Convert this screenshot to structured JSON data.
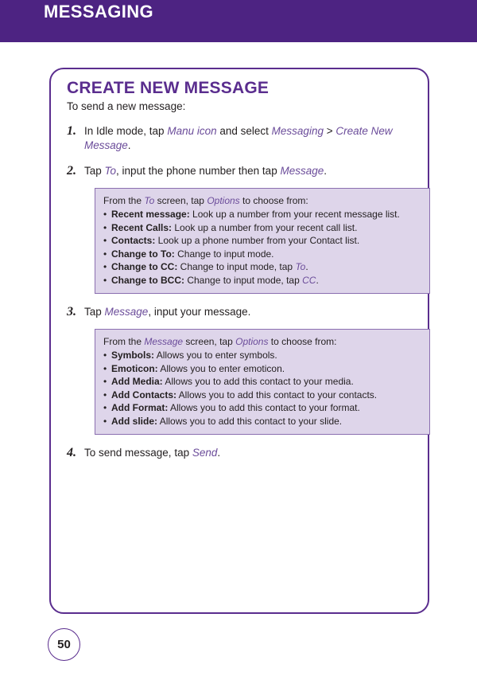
{
  "header": {
    "title": "MESSAGING",
    "bar_color": "#4d2382"
  },
  "card": {
    "section_title": "CREATE NEW MESSAGE",
    "intro": "To send a new message:",
    "border_color": "#5a2d8e",
    "accent_color": "#6b4c9a"
  },
  "steps": [
    {
      "number": "1.",
      "parts": [
        {
          "text": "In Idle mode, tap ",
          "style": "normal"
        },
        {
          "text": "Manu icon",
          "style": "em"
        },
        {
          "text": " and select ",
          "style": "normal"
        },
        {
          "text": "Messaging",
          "style": "em"
        },
        {
          "text": " > ",
          "style": "normal"
        },
        {
          "text": "Create New Message",
          "style": "em"
        },
        {
          "text": ".",
          "style": "normal"
        }
      ]
    },
    {
      "number": "2.",
      "parts": [
        {
          "text": "Tap ",
          "style": "normal"
        },
        {
          "text": "To",
          "style": "em"
        },
        {
          "text": ", input the phone number then tap ",
          "style": "normal"
        },
        {
          "text": "Message",
          "style": "em"
        },
        {
          "text": ".",
          "style": "normal"
        }
      ]
    },
    {
      "number": "3.",
      "parts": [
        {
          "text": "Tap ",
          "style": "normal"
        },
        {
          "text": "Message",
          "style": "em"
        },
        {
          "text": ", input your message.",
          "style": "normal"
        }
      ]
    },
    {
      "number": "4.",
      "parts": [
        {
          "text": "To send message, tap ",
          "style": "normal"
        },
        {
          "text": "Send",
          "style": "em"
        },
        {
          "text": ".",
          "style": "normal"
        }
      ]
    }
  ],
  "infobox_to": {
    "lead_parts": [
      {
        "text": "From the ",
        "style": "normal"
      },
      {
        "text": "To",
        "style": "em"
      },
      {
        "text": " screen, tap ",
        "style": "normal"
      },
      {
        "text": "Options",
        "style": "em"
      },
      {
        "text": " to choose from:",
        "style": "normal"
      }
    ],
    "items": [
      {
        "parts": [
          {
            "text": "Recent message:",
            "style": "bold"
          },
          {
            "text": " Look up a number from your recent message list.",
            "style": "normal"
          }
        ]
      },
      {
        "parts": [
          {
            "text": "Recent Calls:",
            "style": "bold"
          },
          {
            "text": " Look up a number from your recent call list.",
            "style": "normal"
          }
        ]
      },
      {
        "parts": [
          {
            "text": "Contacts:",
            "style": "bold"
          },
          {
            "text": " Look up a phone number from your Contact list.",
            "style": "normal"
          }
        ]
      },
      {
        "parts": [
          {
            "text": "Change to To:",
            "style": "bold"
          },
          {
            "text": " Change to input mode.",
            "style": "normal"
          }
        ]
      },
      {
        "parts": [
          {
            "text": "Change to CC:",
            "style": "bold"
          },
          {
            "text": " Change to input mode, tap ",
            "style": "normal"
          },
          {
            "text": "To",
            "style": "em"
          },
          {
            "text": ".",
            "style": "normal"
          }
        ]
      },
      {
        "parts": [
          {
            "text": "Change to BCC:",
            "style": "bold"
          },
          {
            "text": " Change to input mode, tap ",
            "style": "normal"
          },
          {
            "text": "CC",
            "style": "em"
          },
          {
            "text": ".",
            "style": "normal"
          }
        ]
      }
    ]
  },
  "infobox_message": {
    "lead_parts": [
      {
        "text": "From the ",
        "style": "normal"
      },
      {
        "text": "Message",
        "style": "em"
      },
      {
        "text": " screen, tap ",
        "style": "normal"
      },
      {
        "text": "Options",
        "style": "em"
      },
      {
        "text": " to choose from:",
        "style": "normal"
      }
    ],
    "items": [
      {
        "parts": [
          {
            "text": "Symbols:",
            "style": "bold"
          },
          {
            "text": " Allows you to enter symbols.",
            "style": "normal"
          }
        ]
      },
      {
        "parts": [
          {
            "text": "Emoticon:",
            "style": "bold"
          },
          {
            "text": " Allows you to enter emoticon.",
            "style": "normal"
          }
        ]
      },
      {
        "parts": [
          {
            "text": "Add Media:",
            "style": "bold"
          },
          {
            "text": " Allows you to add this contact to your media.",
            "style": "normal"
          }
        ]
      },
      {
        "parts": [
          {
            "text": "Add Contacts:",
            "style": "bold"
          },
          {
            "text": " Allows you to add this contact to your contacts.",
            "style": "normal"
          }
        ]
      },
      {
        "parts": [
          {
            "text": "Add Format:",
            "style": "bold"
          },
          {
            "text": " Allows you to add this contact to your format.",
            "style": "normal"
          }
        ]
      },
      {
        "parts": [
          {
            "text": "Add slide:",
            "style": "bold"
          },
          {
            "text": " Allows you to add this contact to your slide.",
            "style": "normal"
          }
        ]
      }
    ]
  },
  "footer": {
    "page_number": "50"
  }
}
